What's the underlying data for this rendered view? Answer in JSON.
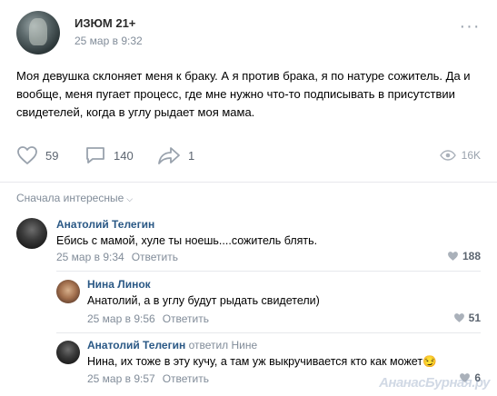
{
  "post": {
    "author": "ИЗЮМ 21+",
    "time": "25 мар в 9:32",
    "text": "Моя девушка склоняет меня к браку. А я против брака, я по натуре сожитель. Да и вообще, меня пугает процесс, где мне нужно что-то подписывать в присутствии свидетелей, когда в углу рыдает моя мама.",
    "likes": "59",
    "comments": "140",
    "shares": "1",
    "views": "16K"
  },
  "sort_label": "Сначала интересные",
  "comments": [
    {
      "name": "Анатолий Телегин",
      "reply_to": "",
      "text": "Ебись с мамой, хуле ты ноешь....сожитель блять.",
      "time": "25 мар в 9:34",
      "reply_label": "Ответить",
      "likes": "188"
    },
    {
      "name": "Нина Линок",
      "reply_to": "",
      "text": "Анатолий, а в углу будут рыдать свидетели)",
      "time": "25 мар в 9:56",
      "reply_label": "Ответить",
      "likes": "51"
    },
    {
      "name": "Анатолий Телегин",
      "reply_to": "ответил Нине",
      "text": "Нина, их тоже в эту кучу, а там уж выкручивается кто как может😏",
      "time": "25 мар в 9:57",
      "reply_label": "Ответить",
      "likes": "6"
    }
  ],
  "watermark": "АнанасБурная.ру",
  "colors": {
    "link": "#2a5885",
    "muted": "#818c99",
    "divider": "#e7e8ec"
  }
}
